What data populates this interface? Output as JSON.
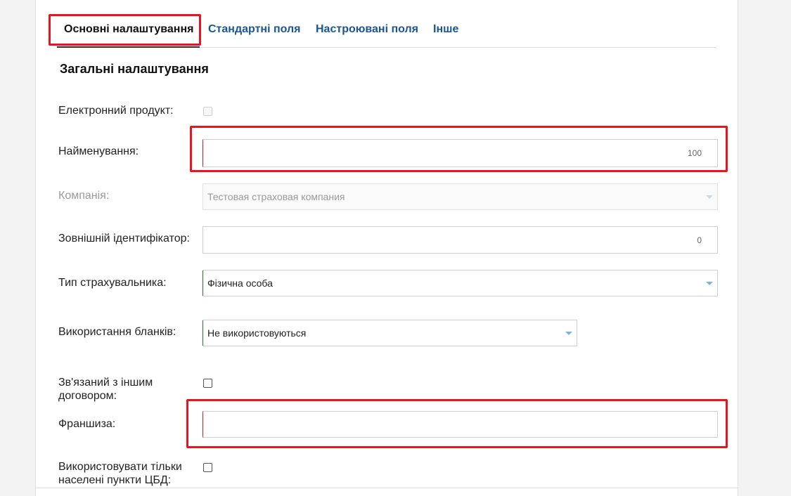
{
  "tabs": [
    {
      "label": "Основні налаштування"
    },
    {
      "label": "Стандартні поля"
    },
    {
      "label": "Настроювані поля"
    },
    {
      "label": "Інше"
    }
  ],
  "section": {
    "title": "Загальні налаштування"
  },
  "form": {
    "electronic_product": {
      "label": "Електронний продукт:"
    },
    "name": {
      "label": "Найменування:",
      "value": "",
      "counter": "100"
    },
    "company": {
      "label": "Компанія:",
      "value": "Тестовая страховая компания"
    },
    "external_id": {
      "label": "Зовнішній ідентифікатор:",
      "value": "",
      "counter": "0"
    },
    "insurer_type": {
      "label": "Тип страхувальника:",
      "value": "Фізична особа"
    },
    "blanks_usage": {
      "label": "Використання бланків:",
      "value": "Не використовуються"
    },
    "linked_contract": {
      "label": "Зв'язаний з іншим договором:"
    },
    "franchise": {
      "label": "Франшиза:",
      "value": ""
    },
    "cbd_localities": {
      "label": "Використовувати тільки населені пункти ЦБД:"
    }
  },
  "colors": {
    "highlight": "#e8141e",
    "tab_link": "#1b5596",
    "caret": "#7fb2dc"
  }
}
